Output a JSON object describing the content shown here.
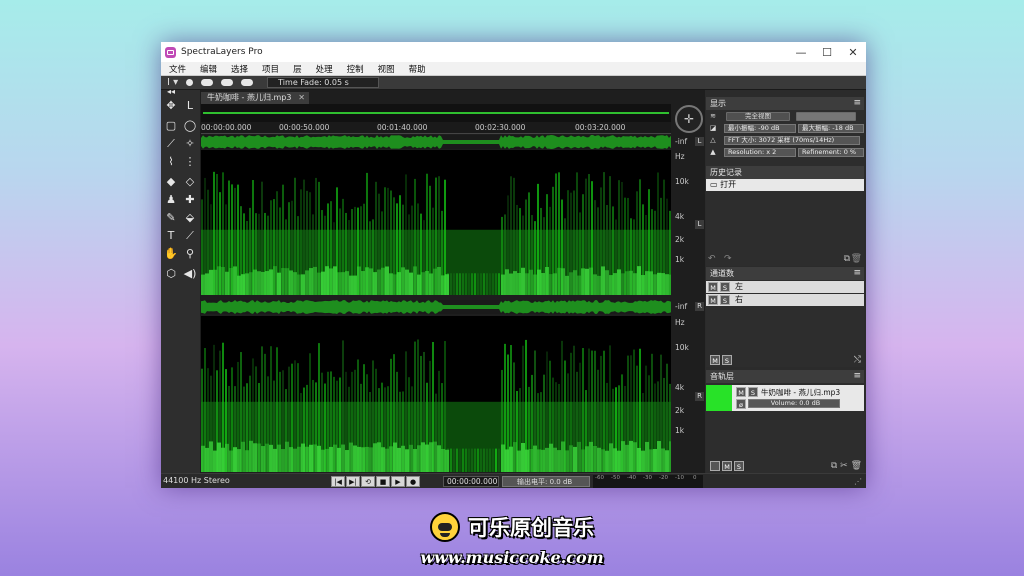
{
  "window": {
    "title": "SpectraLayers Pro",
    "controls": {
      "minimize": "—",
      "maximize": "☐",
      "close": "✕"
    }
  },
  "menu": [
    "文件",
    "编辑",
    "选择",
    "项目",
    "层",
    "处理",
    "控制",
    "视图",
    "帮助"
  ],
  "toolbar": {
    "time_fade": "Time Fade: 0.05 s"
  },
  "document": {
    "tab_label": "牛奶咖啡 - 燕儿归.mp3",
    "ruler_ticks": [
      "00:00:00.000",
      "00:00:50.000",
      "00:01:40.000",
      "00:02:30.000",
      "00:03:20.000"
    ],
    "inf_label": "-inf",
    "hz_label": "Hz",
    "freq_ticks": [
      "10k",
      "4k",
      "2k",
      "1k"
    ],
    "channel_left": "L",
    "channel_right": "R"
  },
  "display_panel": {
    "title": "显示",
    "full_view_button": "完全视图",
    "min_amp": "最小振幅: -90 dB",
    "max_amp": "最大振幅: -18 dB",
    "fft": "FFT 大小: 3072 采样 (70ms/14Hz)",
    "resolution": "Resolution: x 2",
    "refinement": "Refinement: 0 %"
  },
  "history_panel": {
    "title": "历史记录",
    "items": [
      "打开"
    ]
  },
  "channels_panel": {
    "title": "通道数",
    "mute": "M",
    "solo": "S",
    "channels": [
      "左",
      "右"
    ]
  },
  "layers_panel": {
    "title": "音轨层",
    "layer_name": "牛奶咖啡 - 燕儿归.mp3",
    "volume": "Volume: 0.0 dB"
  },
  "status": {
    "format": "44100 Hz Stereo",
    "time": "00:00:00.000",
    "output_level": "输出电平: 0.0 dB",
    "meter_labels": [
      "-60",
      "-50",
      "-40",
      "-30",
      "-20",
      "-10",
      "0"
    ]
  },
  "watermark": {
    "brand": "可乐原创音乐",
    "url": "www.musiccoke.com"
  },
  "colors": {
    "spectrum": "#2fbf2f",
    "background": "#000000"
  }
}
